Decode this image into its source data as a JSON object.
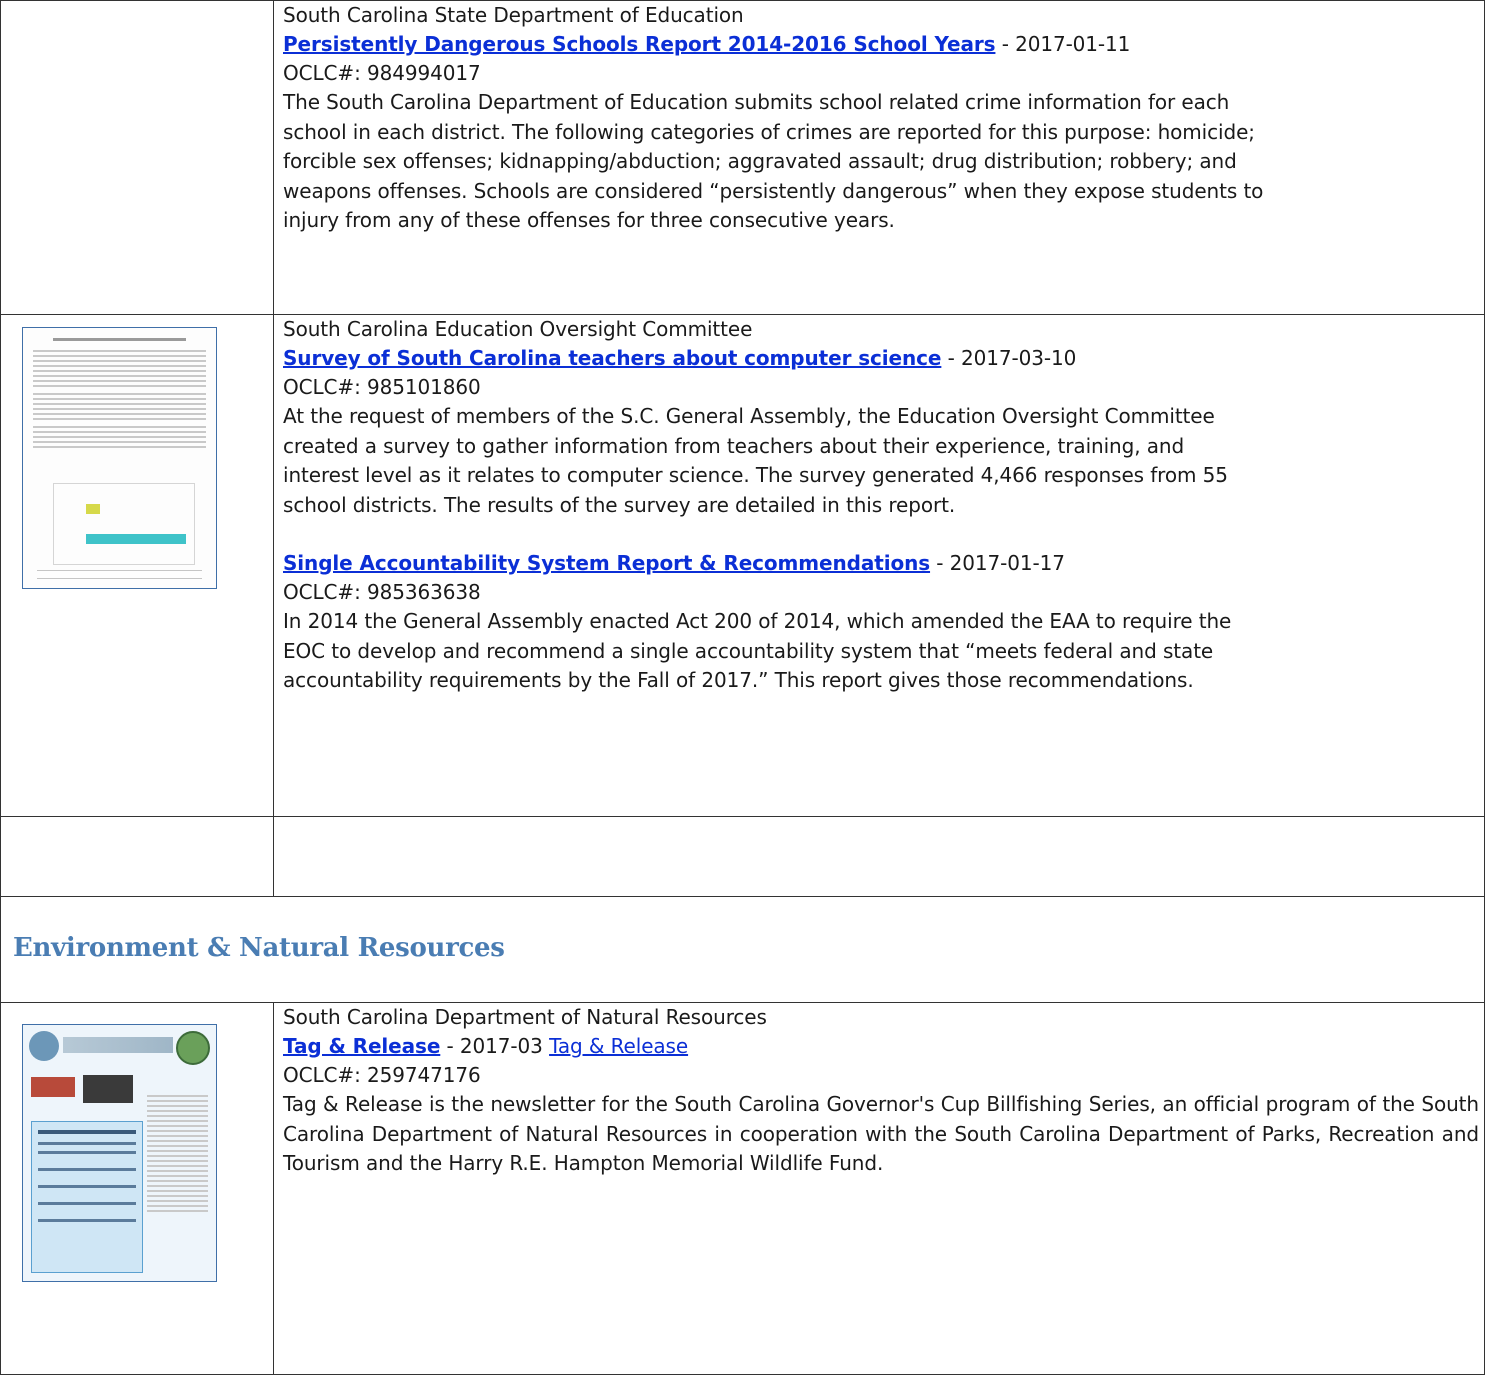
{
  "rows": [
    {
      "thumbnail": null,
      "entries": [
        {
          "agency": "South Carolina State Department of Education",
          "title": "Persistently Dangerous Schools Report 2014-2016 School Years",
          "date": " - 2017-01-11",
          "oclc": "OCLC#: 984994017",
          "lines": [
            "The South Carolina Department of Education submits school related crime information for each",
            "school in each district. The following categories of crimes are reported for this purpose: homicide;",
            "forcible sex offenses; kidnapping/abduction; aggravated assault; drug distribution; robbery; and",
            "weapons offenses. Schools are considered “persistently dangerous” when they expose students to",
            "injury from any of these offenses for three consecutive years."
          ]
        }
      ]
    },
    {
      "thumbnail": "survey-report-cover",
      "entries": [
        {
          "agency": "South Carolina Education Oversight Committee",
          "title": "Survey of South Carolina teachers about computer science",
          "date": " - 2017-03-10",
          "oclc": "OCLC#: 985101860",
          "lines": [
            "At the request of members of the S.C. General Assembly, the Education Oversight Committee",
            "created a survey to gather information from teachers about their experience, training, and",
            "interest level as it relates to computer science. The survey generated 4,466 responses from 55",
            "school districts. The results of the survey are detailed in this report."
          ]
        },
        {
          "agency": "",
          "title": "Single Accountability System Report & Recommendations",
          "date": " - 2017-01-17",
          "oclc": "OCLC#: 985363638",
          "lines": [
            "In 2014 the General Assembly enacted Act 200 of 2014, which amended the EAA to require the",
            "EOC to develop and recommend a single accountability system that “meets federal and state",
            "accountability requirements by the Fall of 2017.” This report gives those recommendations."
          ]
        }
      ]
    }
  ],
  "section": {
    "heading": "Environment & Natural Resources"
  },
  "last_entry": {
    "thumbnail": "tag-and-release-newsletter-cover",
    "agency": "South Carolina Department of Natural Resources",
    "title": "Tag & Release",
    "date": " - 2017-03 ",
    "extra_link": "Tag & Release",
    "oclc": "OCLC#: 259747176",
    "description": "Tag & Release is the newsletter for the South Carolina Governor's Cup Billfishing Series, an official program of the South Carolina Department of Natural Resources in cooperation with the South Carolina Department of Parks, Recreation and Tourism and the Harry R.E. Hampton Memorial Wildlife Fund."
  }
}
